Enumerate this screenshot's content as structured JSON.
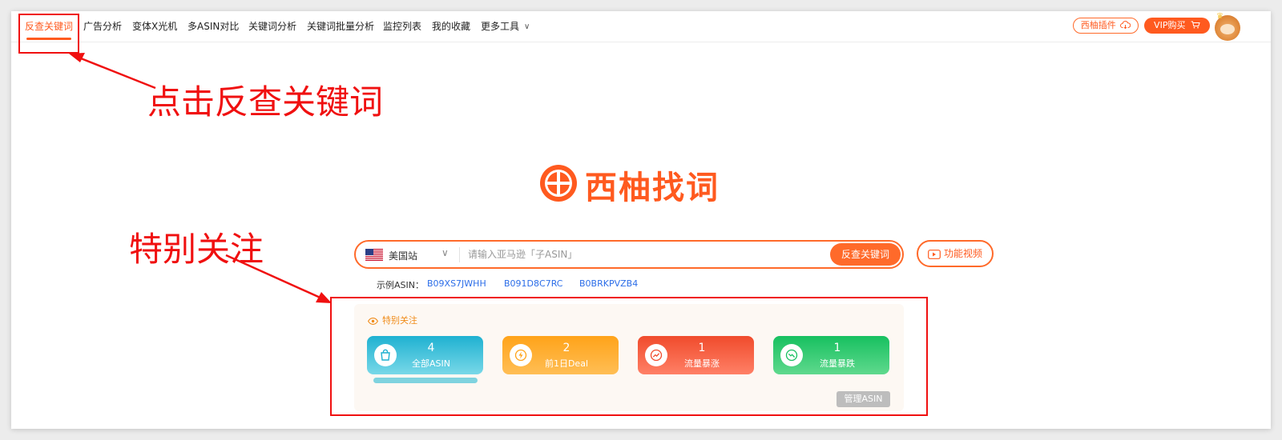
{
  "nav": {
    "items": [
      {
        "label": "反查关键词",
        "active": true
      },
      {
        "label": "广告分析"
      },
      {
        "label": "变体X光机"
      },
      {
        "label": "多ASIN对比"
      },
      {
        "label": "关键词分析"
      },
      {
        "label": "关键词批量分析"
      },
      {
        "label": "监控列表"
      },
      {
        "label": "我的收藏"
      },
      {
        "label": "更多工具"
      }
    ],
    "plugin_label": "西柚插件",
    "vip_label": "VIP购买",
    "accent_color": "#ff5a1f"
  },
  "annotations": {
    "click_hint": "点击反查关键词",
    "focus_hint": "特别关注",
    "color": "#f01010"
  },
  "logo": {
    "text": "西柚找词"
  },
  "search": {
    "site_label": "美国站",
    "placeholder": "请输入亚马逊「子ASIN」",
    "button_label": "反查关键词",
    "video_label": "功能视频"
  },
  "examples": {
    "label": "示例ASIN：",
    "asins": [
      "B09XS7JWHH",
      "B091D8C7RC",
      "B0BRKPVZB4"
    ]
  },
  "follow": {
    "title": "特别关注",
    "cards": [
      {
        "count": "4",
        "label": "全部ASIN",
        "icon": "shopping-bag-icon",
        "color": "#1fb1d1"
      },
      {
        "count": "2",
        "label": "前1日Deal",
        "icon": "lightning-icon",
        "color": "#ffa319"
      },
      {
        "count": "1",
        "label": "流量暴涨",
        "icon": "trend-up-icon",
        "color": "#f04b2c"
      },
      {
        "count": "1",
        "label": "流量暴跌",
        "icon": "trend-down-icon",
        "color": "#17c060"
      }
    ],
    "manage_label": "管理ASIN"
  }
}
